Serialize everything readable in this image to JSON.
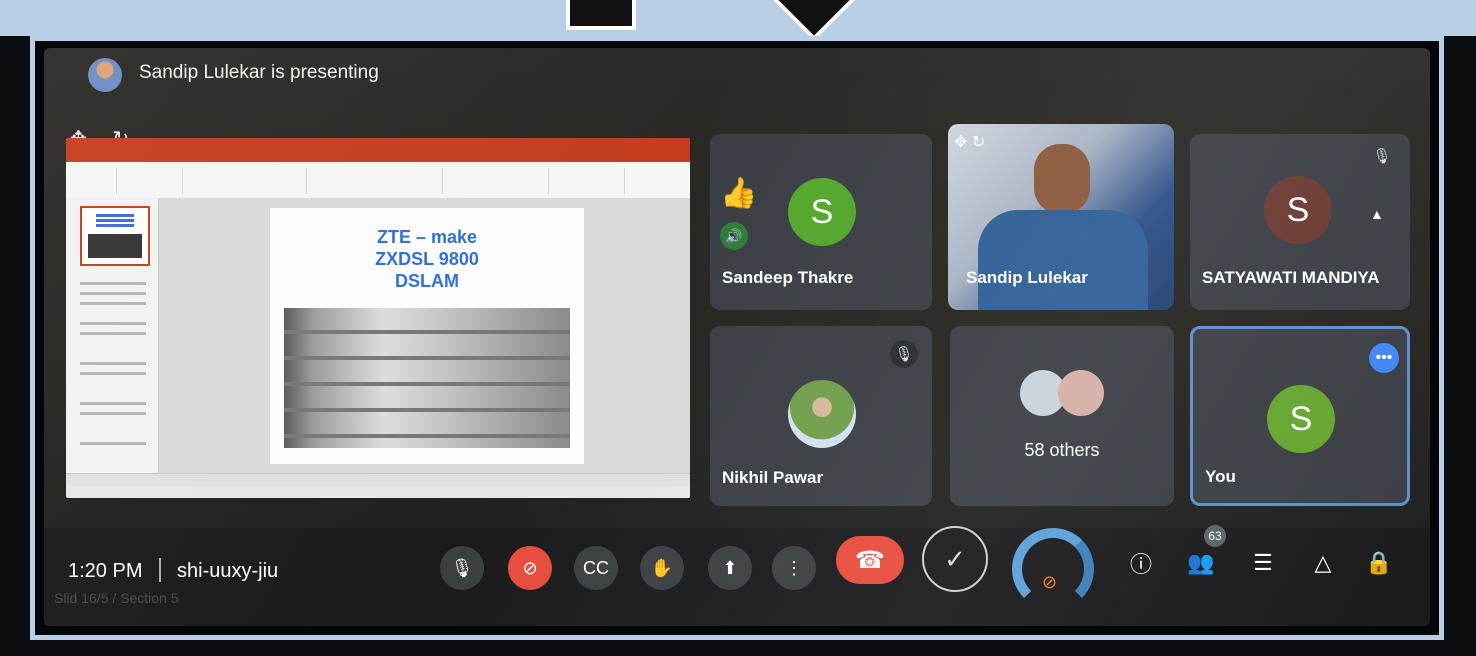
{
  "header": {
    "presenting_text": "Sandip Lulekar is presenting"
  },
  "presentation": {
    "slide_title_lines": [
      "ZTE – make",
      "ZXDSL 9800",
      "DSLAM"
    ]
  },
  "tiles": {
    "sandeep": {
      "name": "Sandeep Thakre",
      "initial": "S",
      "avatar_color": "#53a62b"
    },
    "sandip": {
      "name": "Sandip Lulekar"
    },
    "satyawati": {
      "name": "SATYAWATI MANDIYA",
      "initial": "S",
      "avatar_color": "#6b3a32"
    },
    "nikhil": {
      "name": "Nikhil Pawar"
    },
    "others": {
      "label": "58 others"
    },
    "you": {
      "name": "You",
      "initial": "S",
      "avatar_color": "#66a62f",
      "border_color": "#5a8fd0"
    }
  },
  "bottom_bar": {
    "time": "1:20 PM",
    "meeting_code": "shi-uuxy-jiu",
    "participants_count": "63",
    "ghost_text": "Slid 16/5 / Section 5"
  },
  "icons": {
    "mic": "mic-icon",
    "camera_off": "camera-off-icon",
    "captions": "captions-icon",
    "raise_hand": "raise-hand-icon",
    "present": "present-icon",
    "more": "more-options-icon",
    "end_call": "end-call-icon",
    "info": "info-icon",
    "people": "people-icon",
    "chat": "chat-icon",
    "activities": "activities-icon",
    "host_controls": "host-controls-icon"
  }
}
